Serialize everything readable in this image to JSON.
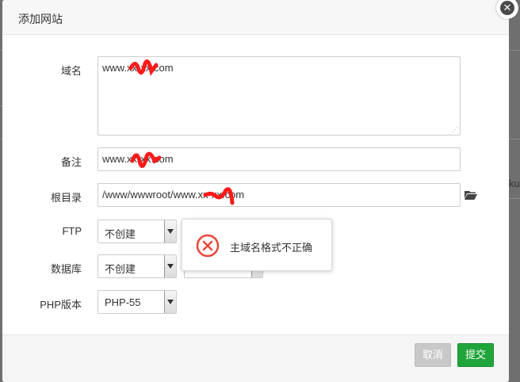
{
  "background": {
    "fragment_text": "ku"
  },
  "dialog": {
    "title": "添加网站",
    "close_icon": "close-icon"
  },
  "form": {
    "domain": {
      "label": "域名",
      "value": "www.xx-xx.com"
    },
    "remark": {
      "label": "备注",
      "value": "www.xx-xx.com"
    },
    "root": {
      "label": "根目录",
      "value": "/www/wwwroot/www.xx-xx.com",
      "icon": "folder-icon"
    },
    "ftp": {
      "label": "FTP",
      "selected": "不创建"
    },
    "database": {
      "label": "数据库",
      "selected": "不创建"
    },
    "php": {
      "label": "PHP版本",
      "selected": "PHP-55"
    }
  },
  "toast": {
    "icon": "error-icon",
    "message": "主域名格式不正确",
    "color": "#e8483c"
  },
  "footer": {
    "cancel_label": "取消",
    "submit_label": "提交"
  },
  "colors": {
    "submit": "#20a53a",
    "cancel": "#c8c8c8",
    "redaction": "#ff0000"
  }
}
